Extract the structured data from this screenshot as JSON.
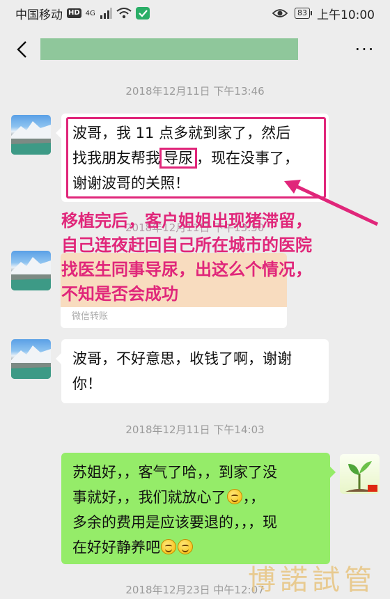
{
  "status_bar": {
    "carrier": "中国移动",
    "hd": "HD",
    "network": "4G",
    "battery": "83",
    "time": "上午10:00"
  },
  "header": {
    "back_icon": "chevron-left-icon",
    "more_label": "···"
  },
  "messages": [
    {
      "timestamp": "2018年12月11日 下午13:46",
      "line1": "波哥，我 11 点多就到家了，然后",
      "line2_pre": "找我朋友帮我",
      "line2_boxed": "导尿",
      "line2_post": "，现在没事了，",
      "line3": "谢谢波哥的关照！"
    },
    {
      "timestamp": "2018年12月11日 下午13:50",
      "transfer_footer": "微信转账"
    },
    {
      "line1": "波哥，不好意思，收钱了啊，谢谢",
      "line2": "你！"
    },
    {
      "timestamp": "2018年12月11日 下午14:03",
      "line1": "苏姐好，，客气了哈，，到家了没",
      "line2": "事就好，，我们就放心了",
      "line2_post": "，，",
      "line3": "多余的费用是应该要退的，，，现",
      "line4": "在好好静养吧"
    },
    {
      "timestamp": "2018年12月23日 中午12:07"
    }
  ],
  "annotation": {
    "line1": "移植完后，客户姐姐出现猪滞留，",
    "line2": "自己连夜赶回自己所在城市的医院",
    "line3": "找医生同事导尿，出这么个情况，",
    "line4": "不知是否会成功"
  },
  "watermark": "博諾試管",
  "colors": {
    "accent_annotation": "#e0267a",
    "sent_bubble": "#95ec69",
    "received_bubble": "#ffffff",
    "background": "#ededed"
  }
}
